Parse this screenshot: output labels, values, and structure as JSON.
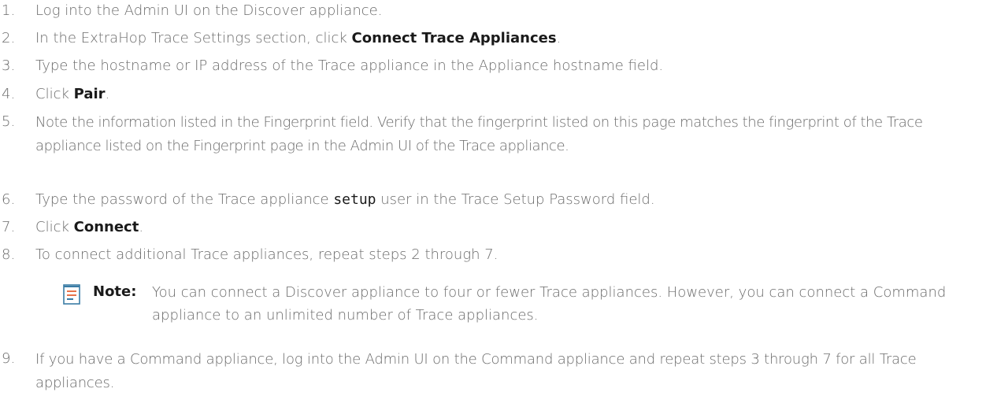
{
  "steps": [
    {
      "num": "1.",
      "text": "Log into the Admin UI on the Discover appliance."
    },
    {
      "num": "2.",
      "pre": "In the ExtraHop Trace Settings section, click ",
      "strong": "Connect Trace Appliances",
      "post": "."
    },
    {
      "num": "3.",
      "text": "Type the hostname or IP address of the Trace appliance in the Appliance hostname field."
    },
    {
      "num": "4.",
      "pre": "Click ",
      "strong": "Pair",
      "post": "."
    },
    {
      "num": "5.",
      "text": "Note the information listed in the Fingerprint field. Verify that the fingerprint listed on this page matches the fingerprint of the Trace appliance listed on the Fingerprint page in the Admin UI of the Trace appliance."
    },
    {
      "num": "6.",
      "pre": "Type the password of the Trace appliance ",
      "code": "setup",
      "post": " user in the Trace Setup Password field."
    },
    {
      "num": "7.",
      "pre": "Click ",
      "strong": "Connect",
      "post": "."
    },
    {
      "num": "8.",
      "text": "To connect additional Trace appliances, repeat steps 2 through 7."
    },
    {
      "num": "9.",
      "text": "If you have a Command appliance, log into the Admin UI on the Command appliance and repeat steps 3 through 7 for all Trace appliances."
    }
  ],
  "note": {
    "label": "Note:",
    "text": "You can connect a Discover appliance to four or fewer Trace appliances. However, you can connect a Command appliance to an unlimited number of Trace appliances.",
    "icon": "note-icon"
  },
  "colors": {
    "text": "#6b6b6b",
    "strong": "#1a1a1a",
    "icon_accent": "#e8734a",
    "icon_lines": "#3a7ca5"
  }
}
